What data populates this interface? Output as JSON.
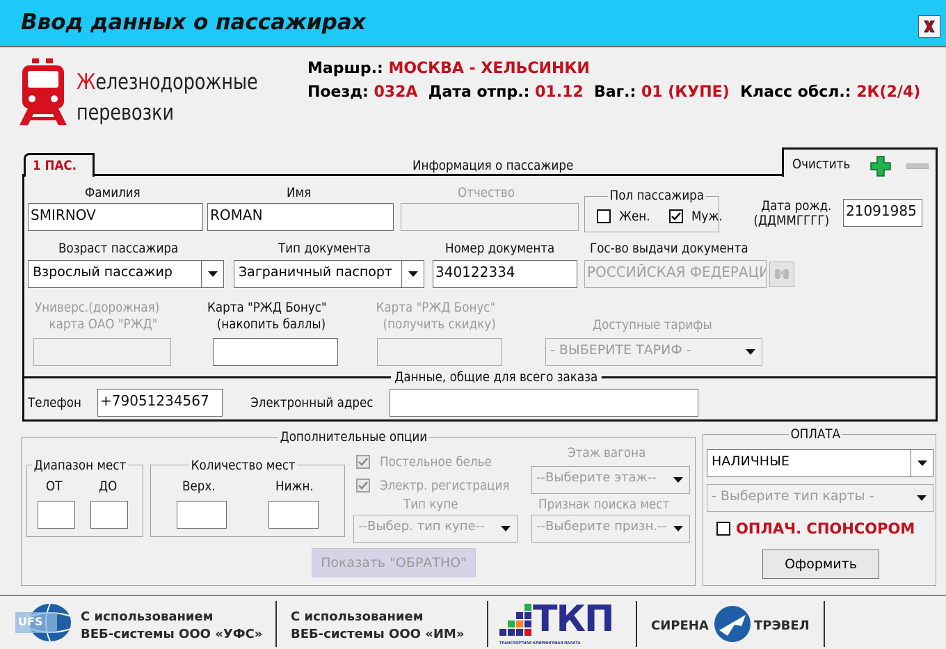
{
  "window": {
    "title": "Ввод данных о пассажирах"
  },
  "brand": {
    "line1": "Железнодорожные",
    "line2": "перевозки",
    "first_letter": "Ж"
  },
  "route": {
    "route_label": "Маршр.:",
    "route_value": "МОСКВА - ХЕЛЬСИНКИ",
    "train_label": "Поезд:",
    "train_value": "032А",
    "date_label": "Дата отпр.:",
    "date_value": "01.12",
    "car_label": "Ваг.:",
    "car_value": "01 (КУПЕ)",
    "class_label": "Класс обсл.:",
    "class_value": "2К(2/4)"
  },
  "tabs": {
    "passenger_tab": "1 ПАС.",
    "panel_title": "Информация о пассажире",
    "clear_label": "Очистить"
  },
  "passenger": {
    "surname_label": "Фамилия",
    "surname_value": "SMIRNOV",
    "name_label": "Имя",
    "name_value": "ROMAN",
    "patronymic_label": "Отчество",
    "patronymic_value": "",
    "gender_label": "Пол пассажира",
    "female_label": "Жен.",
    "male_label": "Муж.",
    "female_checked": false,
    "male_checked": true,
    "birthdate_label1": "Дата рожд.",
    "birthdate_label2": "(ДДММГГГГ)",
    "birthdate_value": "21091985",
    "age_label": "Возраст пассажира",
    "age_value": "Взрослый пассажир",
    "doc_type_label": "Тип документа",
    "doc_type_value": "Заграничный паспорт",
    "doc_number_label": "Номер документа",
    "doc_number_value": "340122334",
    "doc_country_label": "Гос-во выдачи документа",
    "doc_country_value": "РОССИЙСКАЯ ФЕДЕРАЦИ",
    "univ_card_label1": "Универс.(дорожная)",
    "univ_card_label2": "карта ОАО \"РЖД\"",
    "bonus_accum_label1": "Карта \"РЖД Бонус\"",
    "bonus_accum_label2": "(накопить баллы)",
    "bonus_discount_label1": "Карта \"РЖД Бонус\"",
    "bonus_discount_label2": "(получить скидку)",
    "tariffs_label": "Доступные тарифы",
    "tariffs_value": "- ВЫБЕРИТЕ ТАРИФ -"
  },
  "order": {
    "section_title": "Данные, общие для всего заказа",
    "phone_label": "Телефон",
    "phone_value": "+79051234567",
    "email_label": "Электронный адрес",
    "email_value": ""
  },
  "options": {
    "title": "Дополнительные опции",
    "seat_range_label": "Диапазон мест",
    "from_label": "ОТ",
    "to_label": "ДО",
    "seat_count_label": "Количество мест",
    "upper_label": "Верх.",
    "lower_label": "Нижн.",
    "linen_label": "Постельное белье",
    "ereg_label": "Электр. регистрация",
    "compartment_type_label": "Тип купе",
    "compartment_type_value": "--Выбер. тип купе--",
    "floor_label": "Этаж вагона",
    "floor_value": "--Выберите этаж--",
    "search_sign_label": "Признак поиска мест",
    "search_sign_value": "--Выберите призн.--",
    "return_button": "Показать \"ОБРАТНО\""
  },
  "payment": {
    "title": "ОПЛАТА",
    "method_value": "НАЛИЧНЫЕ",
    "card_type_value": "- Выберите тип карты -",
    "sponsor_label": "ОПЛАЧ. СПОНСОРОМ",
    "submit_button": "Оформить"
  },
  "footer": {
    "ufs_line1": "С использованием",
    "ufs_line2": "ВЕБ-системы ООО «УФС»",
    "ufs_logo": "UFS",
    "im_line1": "С использованием",
    "im_line2": "ВЕБ-системы ООО «ИМ»",
    "tkp_logo": "ТКП",
    "tkp_sub": "ТРАНСПОРТНАЯ КЛИРИНГОВАЯ ПАЛАТА",
    "sirena_left": "СИРЕНА",
    "sirena_right": "ТРЭВЕЛ"
  },
  "colors": {
    "titlebar": "#1ec8f7",
    "accent_red": "#c2101b",
    "tkp_blue": "#2a2f8f"
  }
}
